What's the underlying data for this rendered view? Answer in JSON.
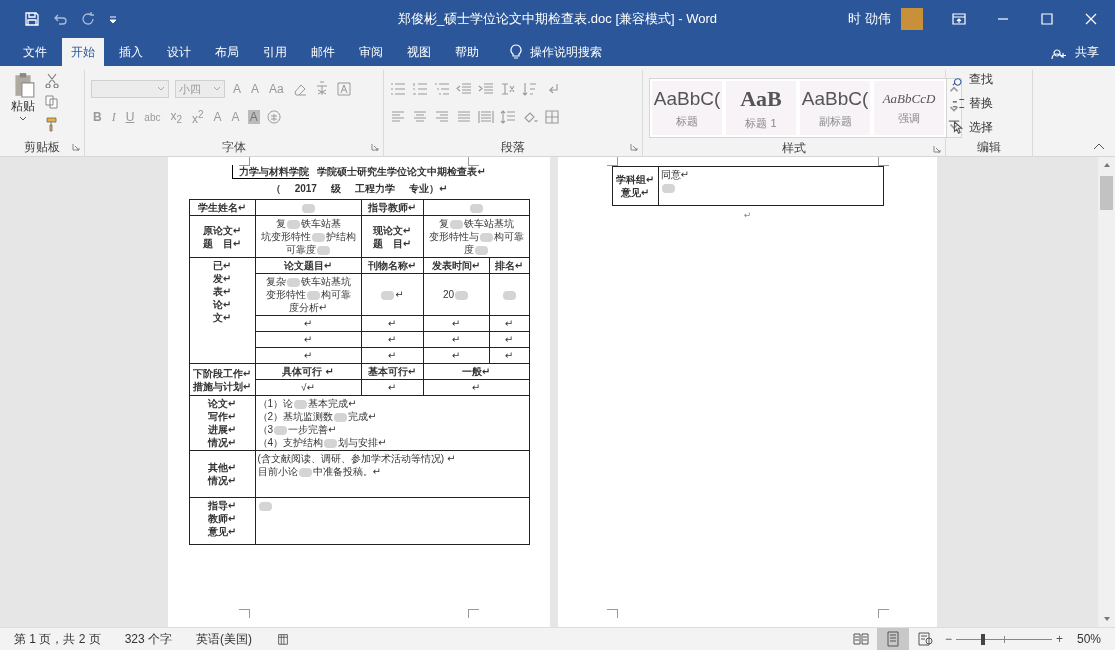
{
  "window": {
    "title": "郑俊彬_硕士学位论文中期检查表.doc [兼容模式] - Word",
    "user": "时 劭伟"
  },
  "ribbon_tabs": [
    {
      "label": "文件",
      "selected": false
    },
    {
      "label": "开始",
      "selected": true
    },
    {
      "label": "插入",
      "selected": false
    },
    {
      "label": "设计",
      "selected": false
    },
    {
      "label": "布局",
      "selected": false
    },
    {
      "label": "引用",
      "selected": false
    },
    {
      "label": "邮件",
      "selected": false
    },
    {
      "label": "审阅",
      "selected": false
    },
    {
      "label": "视图",
      "selected": false
    },
    {
      "label": "帮助",
      "selected": false
    }
  ],
  "tell_me": "操作说明搜索",
  "share": "共享",
  "clipboard": {
    "paste": "粘贴",
    "label": "剪贴板"
  },
  "font": {
    "size": "小四",
    "row1": [
      "A",
      "A",
      "Aa"
    ],
    "row2": [
      "B",
      "I",
      "U",
      "abc",
      "x$_{2}$",
      "x$^{2}$",
      "A",
      "A",
      "A"
    ],
    "label": "字体"
  },
  "paragraph": {
    "label": "段落"
  },
  "styles": {
    "label": "样式",
    "items": [
      {
        "preview": "AaBbC(",
        "name": "标题",
        "kind": "title"
      },
      {
        "preview": "AaB",
        "name": "标题 1",
        "kind": "heading"
      },
      {
        "preview": "AaBbC(",
        "name": "副标题",
        "kind": "subtitle"
      },
      {
        "preview": "AaBbCcD",
        "name": "强调",
        "kind": "emphasis"
      }
    ]
  },
  "editing": {
    "label": "编辑",
    "items": [
      {
        "label": "查找",
        "kind": "find"
      },
      {
        "label": "替换",
        "kind": "replace"
      },
      {
        "label": "选择",
        "kind": "select"
      }
    ]
  },
  "form": {
    "college": "力学与材料学院",
    "title": "学院硕士研究生学位论文中期检查表↵",
    "subtitle": [
      "（",
      "2017",
      "级",
      "工程力学",
      "专业）↵"
    ],
    "student": {
      "label": "学生姓名↵",
      "value": [
        [
          {
            "kind": "blur"
          }
        ]
      ]
    },
    "advisor": {
      "label": "指导教师↵",
      "value": [
        [
          {
            "kind": "blur"
          }
        ]
      ]
    },
    "original_title": {
      "label": [
        "原论文↵",
        "题　目↵"
      ],
      "value": [
        [
          {
            "kind": "text",
            "text": "复"
          },
          {
            "kind": "blur"
          },
          {
            "kind": "text",
            "text": "铁车站基"
          }
        ],
        [
          {
            "kind": "text",
            "text": "坑变形特性"
          },
          {
            "kind": "blur"
          },
          {
            "kind": "text",
            "text": "护结构"
          }
        ],
        [
          {
            "kind": "text",
            "text": "可靠度"
          },
          {
            "kind": "blur"
          }
        ]
      ]
    },
    "current_title": {
      "label": [
        "现论文↵",
        "题　目↵"
      ],
      "value": [
        [
          {
            "kind": "text",
            "text": "复"
          },
          {
            "kind": "blur"
          },
          {
            "kind": "text",
            "text": "铁车站基坑"
          }
        ],
        [
          {
            "kind": "text",
            "text": "变形特性与"
          },
          {
            "kind": "blur"
          },
          {
            "kind": "text",
            "text": "构可靠"
          }
        ],
        [
          {
            "kind": "text",
            "text": "度"
          },
          {
            "kind": "blur"
          }
        ]
      ]
    },
    "papers": {
      "label": [
        "已↵",
        "发↵",
        "表↵",
        "论↵",
        "文↵"
      ],
      "columns": [
        "论文题目↵",
        "刊物名称↵",
        "发表时间↵",
        "排名↵"
      ],
      "rows": [
        [
          [
            [
              {
                "kind": "text",
                "text": "复杂"
              },
              {
                "kind": "blur"
              },
              {
                "kind": "text",
                "text": "铁车站基坑"
              }
            ],
            [
              {
                "kind": "text",
                "text": "变形特性"
              },
              {
                "kind": "blur"
              },
              {
                "kind": "text",
                "text": "构可靠"
              }
            ],
            [
              {
                "kind": "text",
                "text": "度分析↵"
              }
            ]
          ],
          [
            [
              {
                "kind": "blur"
              },
              {
                "kind": "text",
                "text": "↵"
              }
            ]
          ],
          [
            [
              {
                "kind": "text",
                "text": "20"
              },
              {
                "kind": "blur"
              }
            ]
          ],
          [
            [
              {
                "kind": "blur"
              }
            ]
          ]
        ],
        [
          [
            [
              {
                "kind": "text",
                "text": "↵"
              }
            ]
          ],
          [
            [
              {
                "kind": "text",
                "text": "↵"
              }
            ]
          ],
          [
            [
              {
                "kind": "text",
                "text": "↵"
              }
            ]
          ],
          [
            [
              {
                "kind": "text",
                "text": "↵"
              }
            ]
          ]
        ],
        [
          [
            [
              {
                "kind": "text",
                "text": "↵"
              }
            ]
          ],
          [
            [
              {
                "kind": "text",
                "text": "↵"
              }
            ]
          ],
          [
            [
              {
                "kind": "text",
                "text": "↵"
              }
            ]
          ],
          [
            [
              {
                "kind": "text",
                "text": "↵"
              }
            ]
          ]
        ],
        [
          [
            [
              {
                "kind": "text",
                "text": "↵"
              }
            ]
          ],
          [
            [
              {
                "kind": "text",
                "text": "↵"
              }
            ]
          ],
          [
            [
              {
                "kind": "text",
                "text": "↵"
              }
            ]
          ],
          [
            [
              {
                "kind": "text",
                "text": "↵"
              }
            ]
          ]
        ]
      ]
    },
    "next_stage": {
      "label": [
        "下阶段工作↵",
        "措施与计划↵"
      ],
      "columns": [
        "具体可行 ↵",
        "基本可行↵",
        "一般↵"
      ],
      "values": [
        "√↵",
        "↵",
        "↵"
      ]
    },
    "progress": {
      "label": [
        "论文↵",
        "写作↵",
        "进展↵",
        "情况↵"
      ],
      "lines": [
        [
          {
            "kind": "text",
            "text": "（1）论"
          },
          {
            "kind": "blur"
          },
          {
            "kind": "text",
            "text": "基本完成↵"
          }
        ],
        [
          {
            "kind": "text",
            "text": "（2）基坑监测数"
          },
          {
            "kind": "blur"
          },
          {
            "kind": "text",
            "text": "完成↵"
          }
        ],
        [
          {
            "kind": "text",
            "text": "（3"
          },
          {
            "kind": "blur"
          },
          {
            "kind": "text",
            "text": "一步完善↵"
          }
        ],
        [
          {
            "kind": "text",
            "text": "（4）支护结构"
          },
          {
            "kind": "blur"
          },
          {
            "kind": "text",
            "text": "划与安排↵"
          }
        ]
      ]
    },
    "other": {
      "label": [
        "其他↵",
        "情况↵"
      ],
      "lines": [
        [
          {
            "kind": "text",
            "text": "(含文献阅读、调研、参加学术活动等情况) ↵"
          }
        ],
        [
          {
            "kind": "text",
            "text": "目前小论"
          },
          {
            "kind": "blur"
          },
          {
            "kind": "text",
            "text": "中准备投稿。↵"
          }
        ]
      ]
    },
    "advisor_opinion": {
      "label": [
        "指导↵",
        "教师↵",
        "意见↵"
      ],
      "lines": [
        [
          {
            "kind": "blur"
          }
        ]
      ]
    },
    "group_opinion": {
      "label": [
        "学科组↵",
        "意见↵"
      ],
      "lines": [
        [
          {
            "kind": "text",
            "text": "同意↵"
          }
        ],
        [
          {
            "kind": "blur"
          }
        ]
      ]
    },
    "trailing_mark": "↵"
  },
  "status_bar": {
    "page": "第 1 页，共 2 页",
    "words": "323 个字",
    "language": "英语(美国)",
    "views": [
      {
        "kind": "read",
        "selected": false
      },
      {
        "kind": "print",
        "selected": true
      },
      {
        "kind": "web",
        "selected": false
      }
    ],
    "zoom_out": "−",
    "zoom_in": "+",
    "zoom": {
      "level": 0.28,
      "label": "50%"
    }
  }
}
